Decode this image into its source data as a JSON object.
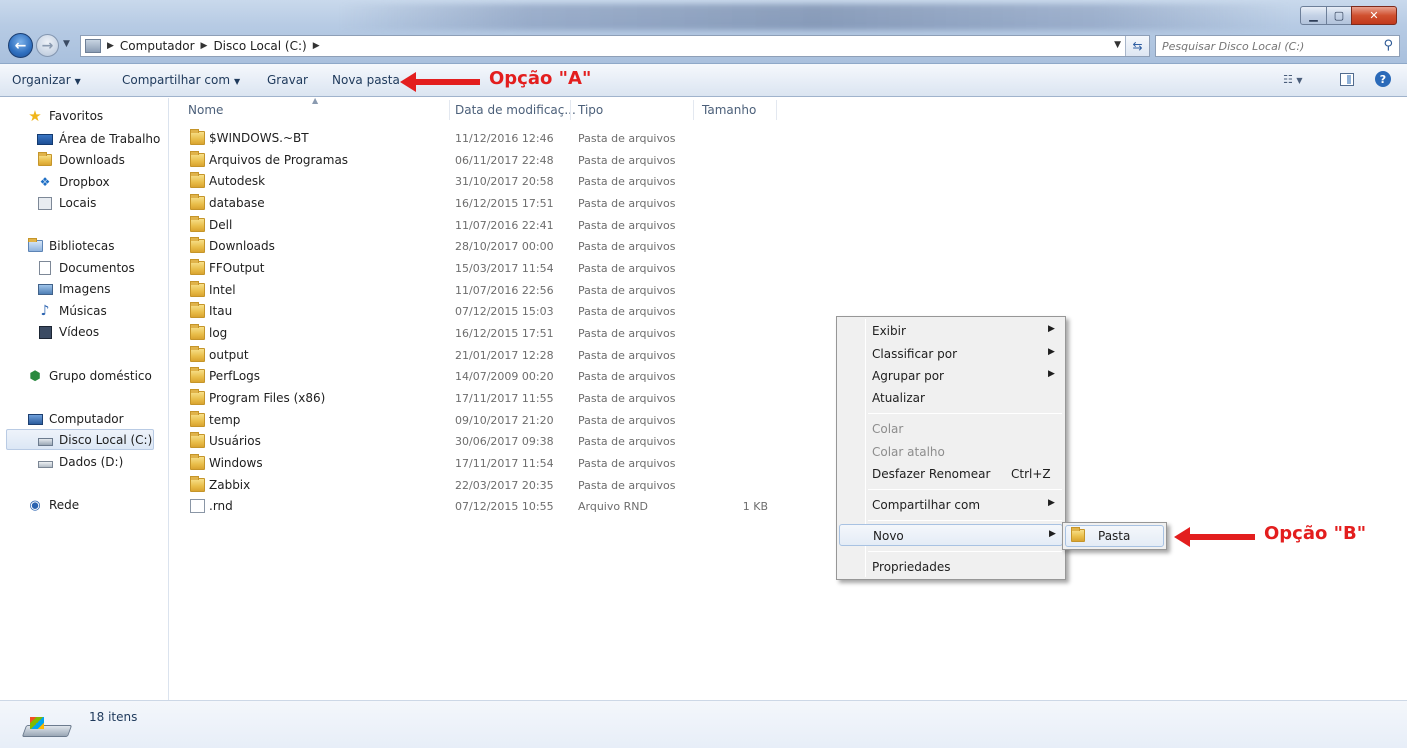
{
  "breadcrumb": [
    "Computador",
    "Disco Local (C:)"
  ],
  "search": {
    "placeholder": "Pesquisar Disco Local (C:)"
  },
  "toolbar": {
    "organize": "Organizar",
    "share": "Compartilhar com",
    "burn": "Gravar",
    "new_folder": "Nova pasta"
  },
  "annotations": {
    "a": "Opção \"A\"",
    "b": "Opção \"B\"",
    "color": "#e31e1e"
  },
  "sidebar": {
    "favorites": {
      "label": "Favoritos",
      "items": [
        "Área de Trabalho",
        "Downloads",
        "Dropbox",
        "Locais"
      ]
    },
    "libraries": {
      "label": "Bibliotecas",
      "items": [
        "Documentos",
        "Imagens",
        "Músicas",
        "Vídeos"
      ]
    },
    "homegroup": "Grupo doméstico",
    "computer": {
      "label": "Computador",
      "items": [
        "Disco Local (C:)",
        "Dados (D:)"
      ]
    },
    "network": "Rede"
  },
  "columns": [
    "Nome",
    "Data de modificaç...",
    "Tipo",
    "Tamanho"
  ],
  "files": [
    {
      "name": "$WINDOWS.~BT",
      "date": "11/12/2016 12:46",
      "type": "Pasta de arquivos",
      "size": ""
    },
    {
      "name": "Arquivos de Programas",
      "date": "06/11/2017 22:48",
      "type": "Pasta de arquivos",
      "size": ""
    },
    {
      "name": "Autodesk",
      "date": "31/10/2017 20:58",
      "type": "Pasta de arquivos",
      "size": ""
    },
    {
      "name": "database",
      "date": "16/12/2015 17:51",
      "type": "Pasta de arquivos",
      "size": ""
    },
    {
      "name": "Dell",
      "date": "11/07/2016 22:41",
      "type": "Pasta de arquivos",
      "size": ""
    },
    {
      "name": "Downloads",
      "date": "28/10/2017 00:00",
      "type": "Pasta de arquivos",
      "size": ""
    },
    {
      "name": "FFOutput",
      "date": "15/03/2017 11:54",
      "type": "Pasta de arquivos",
      "size": ""
    },
    {
      "name": "Intel",
      "date": "11/07/2016 22:56",
      "type": "Pasta de arquivos",
      "size": ""
    },
    {
      "name": "Itau",
      "date": "07/12/2015 15:03",
      "type": "Pasta de arquivos",
      "size": ""
    },
    {
      "name": "log",
      "date": "16/12/2015 17:51",
      "type": "Pasta de arquivos",
      "size": ""
    },
    {
      "name": "output",
      "date": "21/01/2017 12:28",
      "type": "Pasta de arquivos",
      "size": ""
    },
    {
      "name": "PerfLogs",
      "date": "14/07/2009 00:20",
      "type": "Pasta de arquivos",
      "size": ""
    },
    {
      "name": "Program Files (x86)",
      "date": "17/11/2017 11:55",
      "type": "Pasta de arquivos",
      "size": ""
    },
    {
      "name": "temp",
      "date": "09/10/2017 21:20",
      "type": "Pasta de arquivos",
      "size": ""
    },
    {
      "name": "Usuários",
      "date": "30/06/2017 09:38",
      "type": "Pasta de arquivos",
      "size": ""
    },
    {
      "name": "Windows",
      "date": "17/11/2017 11:54",
      "type": "Pasta de arquivos",
      "size": ""
    },
    {
      "name": "Zabbix",
      "date": "22/03/2017 20:35",
      "type": "Pasta de arquivos",
      "size": ""
    },
    {
      "name": ".rnd",
      "date": "07/12/2015 10:55",
      "type": "Arquivo RND",
      "size": "1 KB"
    }
  ],
  "context_menu": {
    "view": "Exibir",
    "sort_by": "Classificar por",
    "group_by": "Agrupar por",
    "refresh": "Atualizar",
    "paste": "Colar",
    "paste_shortcut": "Colar atalho",
    "undo_rename": "Desfazer Renomear",
    "undo_shortcut": "Ctrl+Z",
    "share_with": "Compartilhar com",
    "new": "Novo",
    "properties": "Propriedades"
  },
  "submenu": {
    "folder": "Pasta"
  },
  "status": {
    "count": "18 itens"
  }
}
